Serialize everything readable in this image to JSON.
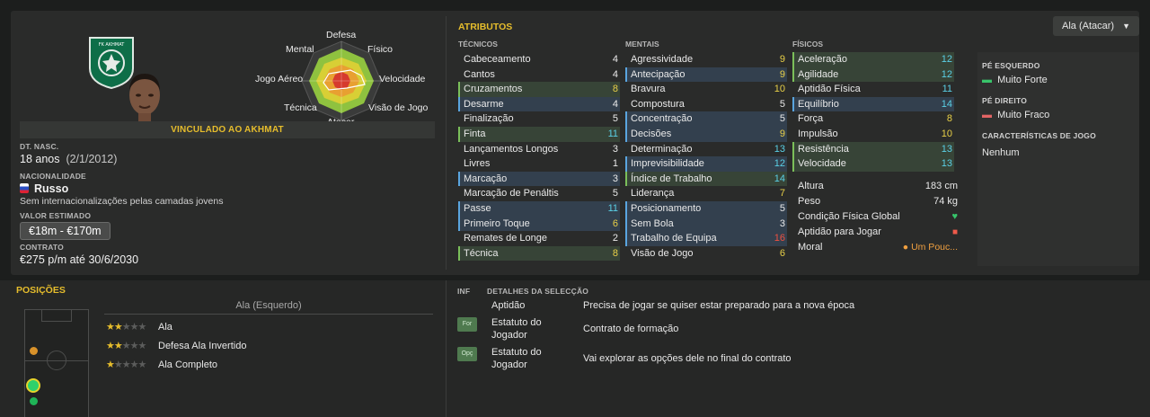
{
  "profile": {
    "club_short": "FK AKHMAT",
    "contract_banner": "VINCULADO AO AKHMAT",
    "dob_label": "DT. NASC.",
    "age": "18 anos",
    "dob": "(2/1/2012)",
    "nationality_label": "NACIONALIDADE",
    "nationality": "Russo",
    "caps": "Sem internacionalizações pelas camadas jovens",
    "value_label": "VALOR ESTIMADO",
    "value": "€18m - €170m",
    "contract_label": "CONTRATO",
    "contract": "€275 p/m até 30/6/2030"
  },
  "radar": {
    "labels": [
      "Defesa",
      "Físico",
      "Velocidade",
      "Visão de Jogo",
      "Atacar",
      "Técnica",
      "Jogo Aéreo",
      "Mental"
    ]
  },
  "attributes": {
    "title": "ATRIBUTOS",
    "role_dropdown": "Ala (Atacar)",
    "tecnicos_label": "TÉCNICOS",
    "mentais_label": "MENTAIS",
    "fisicos_label": "FÍSICOS",
    "tecnicos": [
      {
        "name": "Cabeceamento",
        "value": "4",
        "hl": ""
      },
      {
        "name": "Cantos",
        "value": "4",
        "hl": ""
      },
      {
        "name": "Cruzamentos",
        "value": "8",
        "hl": "g"
      },
      {
        "name": "Desarme",
        "value": "4",
        "hl": "b"
      },
      {
        "name": "Finalização",
        "value": "5",
        "hl": ""
      },
      {
        "name": "Finta",
        "value": "11",
        "hl": "g"
      },
      {
        "name": "Lançamentos Longos",
        "value": "3",
        "hl": ""
      },
      {
        "name": "Livres",
        "value": "1",
        "hl": ""
      },
      {
        "name": "Marcação",
        "value": "3",
        "hl": "b"
      },
      {
        "name": "Marcação de Penáltis",
        "value": "5",
        "hl": ""
      },
      {
        "name": "Passe",
        "value": "11",
        "hl": "b"
      },
      {
        "name": "Primeiro Toque",
        "value": "6",
        "hl": "b"
      },
      {
        "name": "Remates de Longe",
        "value": "2",
        "hl": ""
      },
      {
        "name": "Técnica",
        "value": "8",
        "hl": "g"
      }
    ],
    "mentais": [
      {
        "name": "Agressividade",
        "value": "9",
        "hl": ""
      },
      {
        "name": "Antecipação",
        "value": "9",
        "hl": "b"
      },
      {
        "name": "Bravura",
        "value": "10",
        "hl": ""
      },
      {
        "name": "Compostura",
        "value": "5",
        "hl": ""
      },
      {
        "name": "Concentração",
        "value": "5",
        "hl": "b"
      },
      {
        "name": "Decisões",
        "value": "9",
        "hl": "b"
      },
      {
        "name": "Determinação",
        "value": "13",
        "hl": ""
      },
      {
        "name": "Imprevisibilidade",
        "value": "12",
        "hl": "b"
      },
      {
        "name": "Índice de Trabalho",
        "value": "14",
        "hl": "g"
      },
      {
        "name": "Liderança",
        "value": "7",
        "hl": ""
      },
      {
        "name": "Posicionamento",
        "value": "5",
        "hl": "b"
      },
      {
        "name": "Sem Bola",
        "value": "3",
        "hl": "b"
      },
      {
        "name": "Trabalho de Equipa",
        "value": "16",
        "hl": "b"
      },
      {
        "name": "Visão de Jogo",
        "value": "6",
        "hl": ""
      }
    ],
    "fisicos": [
      {
        "name": "Aceleração",
        "value": "12",
        "hl": "g"
      },
      {
        "name": "Agilidade",
        "value": "12",
        "hl": "g"
      },
      {
        "name": "Aptidão Física",
        "value": "11",
        "hl": ""
      },
      {
        "name": "Equilíbrio",
        "value": "14",
        "hl": "b"
      },
      {
        "name": "Força",
        "value": "8",
        "hl": ""
      },
      {
        "name": "Impulsão",
        "value": "10",
        "hl": ""
      },
      {
        "name": "Resistência",
        "value": "13",
        "hl": "g"
      },
      {
        "name": "Velocidade",
        "value": "13",
        "hl": "g"
      }
    ],
    "altura_label": "Altura",
    "altura": "183 cm",
    "peso_label": "Peso",
    "peso": "74 kg",
    "condicao_label": "Condição Física Global",
    "aptidao_label": "Aptidão para Jogar",
    "moral_label": "Moral",
    "moral": "Um Pouc..."
  },
  "side": {
    "left_foot_label": "PÉ ESQUERDO",
    "left_foot": "Muito Forte",
    "right_foot_label": "PÉ DIREITO",
    "right_foot": "Muito Fraco",
    "traits_label": "CARACTERÍSTICAS DE JOGO",
    "traits": "Nenhum"
  },
  "positions": {
    "title": "POSIÇÕES",
    "selected": "Ala (Esquerdo)",
    "roles": [
      {
        "name": "Ala",
        "stars": 2
      },
      {
        "name": "Defesa Ala Invertido",
        "stars": 2
      },
      {
        "name": "Ala Completo",
        "stars": 1
      }
    ]
  },
  "info": {
    "inf_label": "INF",
    "detail_label": "DETALHES DA SELECÇÃO",
    "rows": [
      {
        "badge": "",
        "title": "Aptidão",
        "text": "Precisa de jogar se quiser estar preparado para a nova época"
      },
      {
        "badge": "For",
        "title": "Estatuto do Jogador",
        "text": "Contrato de formação"
      },
      {
        "badge": "Opç",
        "title": "Estatuto do Jogador",
        "text": "Vai explorar as opções dele no final do contrato"
      }
    ]
  },
  "colors": {
    "accent": "#e6bd2c",
    "green_bar": "#7bbf5a",
    "blue_bar": "#5aa5df",
    "high_value": "#f05040",
    "cyan_value": "#5ad0e6"
  }
}
